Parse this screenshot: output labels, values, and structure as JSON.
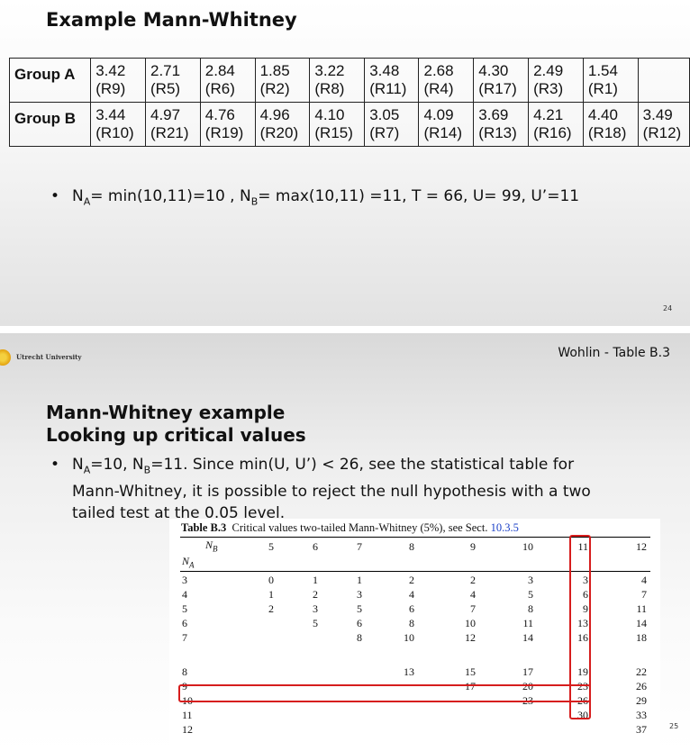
{
  "slide1": {
    "title": "Example Mann-Whitney",
    "groups": [
      {
        "name": "Group A",
        "cells": [
          {
            "value": "3.42",
            "rank": "(R9)"
          },
          {
            "value": "2.71",
            "rank": "(R5)"
          },
          {
            "value": "2.84",
            "rank": "(R6)"
          },
          {
            "value": "1.85",
            "rank": "(R2)"
          },
          {
            "value": "3.22",
            "rank": "(R8)"
          },
          {
            "value": "3.48",
            "rank": "(R11)"
          },
          {
            "value": "2.68",
            "rank": "(R4)"
          },
          {
            "value": "4.30",
            "rank": "(R17)"
          },
          {
            "value": "2.49",
            "rank": "(R3)"
          },
          {
            "value": "1.54",
            "rank": "(R1)"
          },
          {
            "value": "",
            "rank": ""
          }
        ]
      },
      {
        "name": "Group B",
        "cells": [
          {
            "value": "3.44",
            "rank": "(R10)"
          },
          {
            "value": "4.97",
            "rank": "(R21)"
          },
          {
            "value": "4.76",
            "rank": "(R19)"
          },
          {
            "value": "4.96",
            "rank": "(R20)"
          },
          {
            "value": "4.10",
            "rank": "(R15)"
          },
          {
            "value": "3.05",
            "rank": "(R7)"
          },
          {
            "value": "4.09",
            "rank": "(R14)"
          },
          {
            "value": "3.69",
            "rank": "(R13)"
          },
          {
            "value": "4.21",
            "rank": "(R16)"
          },
          {
            "value": "4.40",
            "rank": "(R18)"
          },
          {
            "value": "3.49",
            "rank": "(R12)"
          }
        ]
      }
    ],
    "bullet": "• N_A= min(10,11)=10 , N_B= max(10,11) =11, T = 66, U= 99, U’=11",
    "page_number": "24"
  },
  "slide2": {
    "university": "Utrecht University",
    "source": "Wohlin - Table B.3",
    "title_line1": "Mann-Whitney example",
    "title_line2": "Looking up critical values",
    "bullet": "• N_A=10, N_B=11. Since min(U, U’) < 26, see the statistical table for Mann-Whitney, it is possible to reject the null hypothesis with a two tailed test at the 0.05 level.",
    "bullet_line1": "N_A=10, N_B=11. Since min(U, U’) < 26, see the statistical table for",
    "bullet_line2": "Mann-Whitney, it is possible to reject the null hypothesis with a two",
    "bullet_line3": "tailed test at the 0.05 level.",
    "page_number": "25",
    "table": {
      "caption_label": "Table B.3",
      "caption_text": "Critical values two-tailed Mann-Whitney (5%), see Sect.",
      "caption_ref": "10.3.5",
      "col_axis": "N_B",
      "row_axis": "N_A",
      "col_headers": [
        "5",
        "6",
        "7",
        "8",
        "9",
        "10",
        "11",
        "12"
      ],
      "rows": [
        {
          "na": "3",
          "values": [
            "",
            "0",
            "1",
            "1",
            "2",
            "2",
            "3",
            "3",
            "4"
          ]
        },
        {
          "na": "4",
          "values": [
            "",
            "1",
            "2",
            "3",
            "4",
            "4",
            "5",
            "6",
            "7"
          ]
        },
        {
          "na": "5",
          "values": [
            "",
            "2",
            "3",
            "5",
            "6",
            "7",
            "8",
            "9",
            "11"
          ]
        },
        {
          "na": "6",
          "values": [
            "",
            "",
            "5",
            "6",
            "8",
            "10",
            "11",
            "13",
            "14"
          ]
        },
        {
          "na": "7",
          "values": [
            "",
            "",
            "",
            "8",
            "10",
            "12",
            "14",
            "16",
            "18"
          ]
        },
        {
          "na": "8",
          "values": [
            "",
            "",
            "",
            "",
            "13",
            "15",
            "17",
            "19",
            "22"
          ]
        },
        {
          "na": "9",
          "values": [
            "",
            "",
            "",
            "",
            "",
            "17",
            "20",
            "23",
            "26"
          ]
        },
        {
          "na": "10",
          "values": [
            "",
            "",
            "",
            "",
            "",
            "",
            "23",
            "26",
            "29"
          ]
        },
        {
          "na": "11",
          "values": [
            "",
            "",
            "",
            "",
            "",
            "",
            "",
            "30",
            "33"
          ]
        },
        {
          "na": "12",
          "values": [
            "",
            "",
            "",
            "",
            "",
            "",
            "",
            "",
            "37"
          ]
        }
      ]
    }
  }
}
